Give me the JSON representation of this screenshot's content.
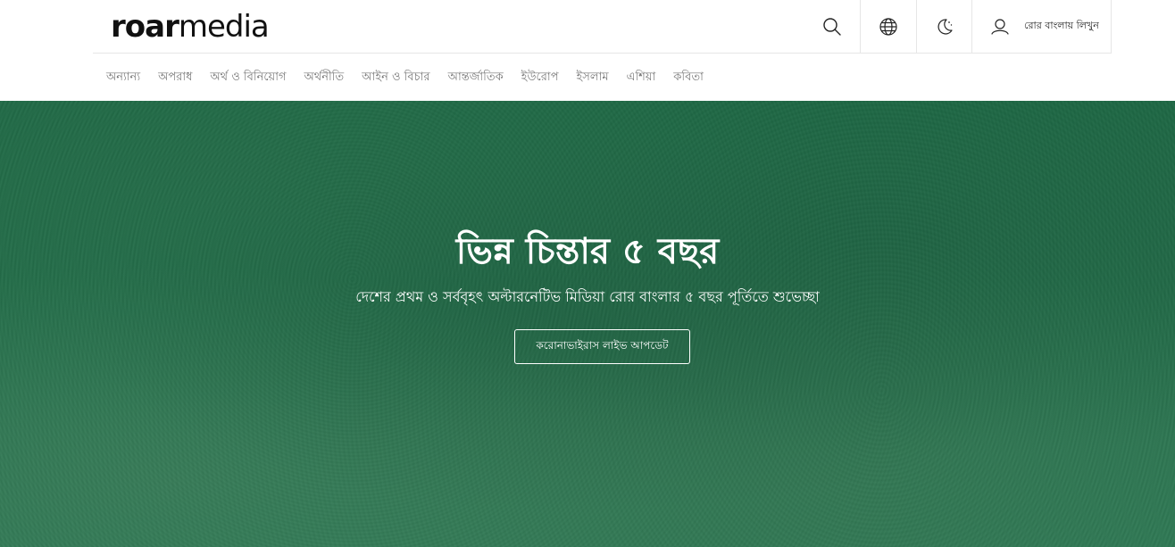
{
  "logo": {
    "part1": "ro",
    "part2": "ar",
    "part3": "media"
  },
  "toolbar": {
    "search_icon": "search-icon",
    "globe_icon": "globe-icon",
    "moon_icon": "moon-icon",
    "user_icon": "user-icon",
    "write_label": "রোর বাংলায় লিখুন"
  },
  "nav": {
    "items": [
      {
        "label": "অন্যান্য"
      },
      {
        "label": "অপরাধ"
      },
      {
        "label": "অর্থ ও বিনিয়োগ"
      },
      {
        "label": "অর্থনীতি"
      },
      {
        "label": "আইন ও বিচার"
      },
      {
        "label": "আন্তর্জাতিক"
      },
      {
        "label": "ইউরোপ"
      },
      {
        "label": "ইসলাম"
      },
      {
        "label": "এশিয়া"
      },
      {
        "label": "কবিতা"
      }
    ]
  },
  "hero": {
    "title": "ভিন্ন চিন্তার ৫ বছর",
    "subtitle": "দেশের প্রথম ও সর্ববৃহৎ অল্টারনেটিভ মিডিয়া রোর বাংলার ৫ বছর পূর্তিতে শুভেচ্ছা",
    "button_label": "করোনাভাইরাস লাইভ আপডেট"
  },
  "colors": {
    "hero_background": "#226e49",
    "nav_text": "#777777",
    "logo_text": "#111111"
  }
}
